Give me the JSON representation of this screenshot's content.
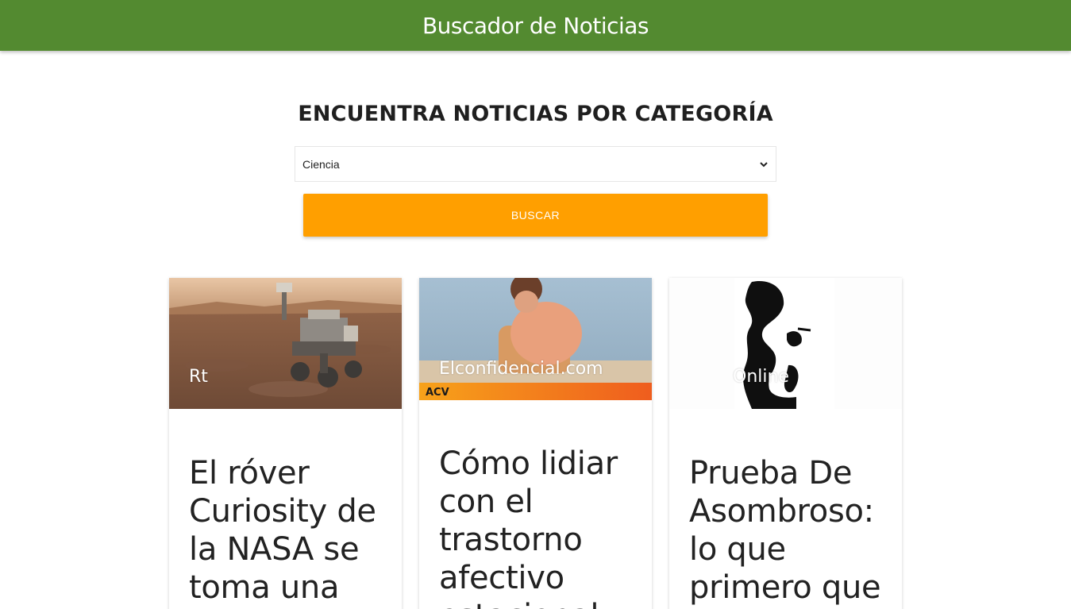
{
  "navbar": {
    "title": "Buscador de Noticias"
  },
  "form": {
    "heading": "ENCUENTRA NOTICIAS POR CATEGORÍA",
    "category_selected": "Ciencia",
    "search_label": "Buscar"
  },
  "cards": [
    {
      "source": "Rt",
      "title": "El róver Curiosity de la NASA se toma una"
    },
    {
      "source": "Elconfidencial.com",
      "title": "Cómo lidiar con el trastorno afectivo estacional"
    },
    {
      "source": "Online",
      "title": "Prueba De Asombroso: lo que primero que"
    }
  ],
  "colors": {
    "navbar": "#538a30",
    "button": "#ff9f00"
  }
}
